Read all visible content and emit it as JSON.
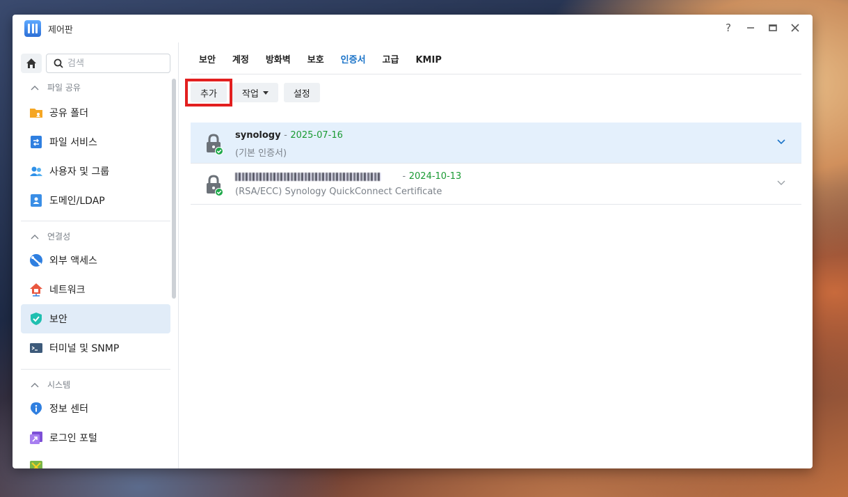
{
  "window": {
    "title": "제어판"
  },
  "window_controls": {
    "help": "?",
    "minimize": "—",
    "maximize": "▢",
    "close": "✕"
  },
  "sidebar": {
    "search_placeholder": "검색",
    "sections": [
      {
        "label": "파일 공유",
        "items": [
          {
            "label": "공유 폴더",
            "icon": "shared-folder-icon"
          },
          {
            "label": "파일 서비스",
            "icon": "file-services-icon"
          },
          {
            "label": "사용자 및 그룹",
            "icon": "users-groups-icon"
          },
          {
            "label": "도메인/LDAP",
            "icon": "domain-ldap-icon"
          }
        ]
      },
      {
        "label": "연결성",
        "items": [
          {
            "label": "외부 액세스",
            "icon": "external-access-icon"
          },
          {
            "label": "네트워크",
            "icon": "network-icon"
          },
          {
            "label": "보안",
            "icon": "security-shield-icon",
            "active": true
          },
          {
            "label": "터미널 및 SNMP",
            "icon": "terminal-icon"
          }
        ]
      },
      {
        "label": "시스템",
        "items": [
          {
            "label": "정보 센터",
            "icon": "info-center-icon"
          },
          {
            "label": "로그인 포털",
            "icon": "login-portal-icon"
          }
        ]
      }
    ]
  },
  "main": {
    "tabs": [
      {
        "label": "보안"
      },
      {
        "label": "계정"
      },
      {
        "label": "방화벽"
      },
      {
        "label": "보호"
      },
      {
        "label": "인증서",
        "active": true
      },
      {
        "label": "고급"
      },
      {
        "label": "KMIP"
      }
    ],
    "toolbar": {
      "add": "추가",
      "action": "작업",
      "settings": "설정"
    },
    "certificates": [
      {
        "name": "synology",
        "separator": "-",
        "date": "2025-07-16",
        "description": "(기본 인증서)",
        "selected": true
      },
      {
        "name": "",
        "separator": "-",
        "date": "2024-10-13",
        "description": "(RSA/ECC) Synology QuickConnect Certificate",
        "selected": false
      }
    ]
  },
  "colors": {
    "accent": "#1a73c8",
    "date_green": "#1a9a33",
    "highlight_red": "#e21f1f",
    "selected_row": "#e4f0fc"
  }
}
